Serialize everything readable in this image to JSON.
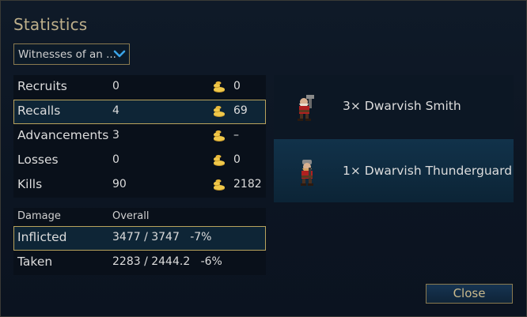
{
  "window": {
    "title": "Statistics"
  },
  "dropdown": {
    "selected": "Witnesses of an ..."
  },
  "stats": [
    {
      "label": "Recruits",
      "count": "0",
      "gold": "0",
      "selected": false
    },
    {
      "label": "Recalls",
      "count": "4",
      "gold": "69",
      "selected": true
    },
    {
      "label": "Advancements",
      "count": "3",
      "gold": "–",
      "selected": false
    },
    {
      "label": "Losses",
      "count": "0",
      "gold": "0",
      "selected": false
    },
    {
      "label": "Kills",
      "count": "90",
      "gold": "2182",
      "selected": false
    }
  ],
  "damage": {
    "header_label": "Damage",
    "header_mode": "Overall",
    "rows": [
      {
        "label": "Inflicted",
        "value": "3477 / 3747   -7%",
        "selected": true
      },
      {
        "label": "Taken",
        "value": "2283 / 2444.2   -6%",
        "selected": false
      }
    ]
  },
  "units": [
    {
      "name": "3× Dwarvish Smith",
      "icon": "dwarvish-smith-sprite"
    },
    {
      "name": "1× Dwarvish Thunderguard",
      "icon": "dwarvish-thunderguard-sprite"
    }
  ],
  "buttons": {
    "close": "Close"
  },
  "colors": {
    "accent_gold": "#b8a25c",
    "title": "#bcae8a",
    "button_text": "#c9b98c"
  }
}
